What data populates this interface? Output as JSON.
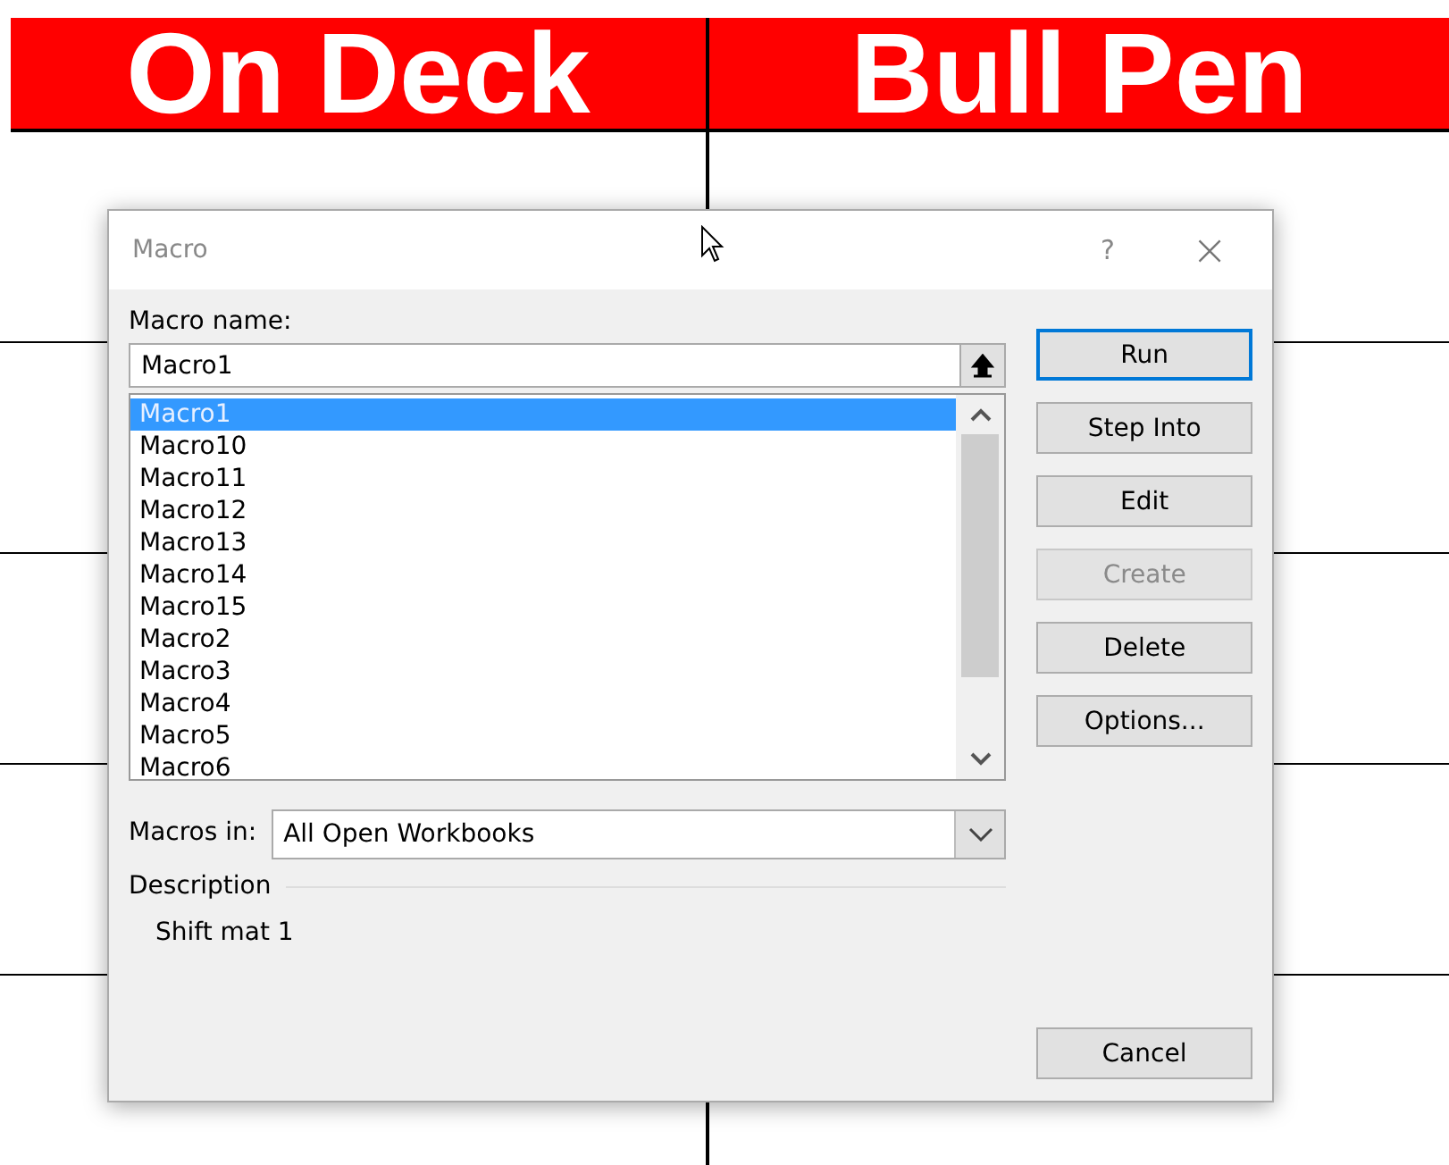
{
  "sheet": {
    "headers": [
      "On Deck",
      "Bull Pen"
    ]
  },
  "dialog": {
    "title": "Macro",
    "help": "?",
    "close": "×",
    "name_label": "Macro name:",
    "name_value": "Macro1",
    "macros": [
      {
        "label": "Macro1",
        "selected": true
      },
      {
        "label": "Macro10",
        "selected": false
      },
      {
        "label": "Macro11",
        "selected": false
      },
      {
        "label": "Macro12",
        "selected": false
      },
      {
        "label": "Macro13",
        "selected": false
      },
      {
        "label": "Macro14",
        "selected": false
      },
      {
        "label": "Macro15",
        "selected": false
      },
      {
        "label": "Macro2",
        "selected": false
      },
      {
        "label": "Macro3",
        "selected": false
      },
      {
        "label": "Macro4",
        "selected": false
      },
      {
        "label": "Macro5",
        "selected": false
      },
      {
        "label": "Macro6",
        "selected": false
      }
    ],
    "buttons": [
      {
        "label": "Run",
        "default": true,
        "disabled": false
      },
      {
        "label": "Step Into",
        "default": false,
        "disabled": false
      },
      {
        "label": "Edit",
        "default": false,
        "disabled": false
      },
      {
        "label": "Create",
        "default": false,
        "disabled": true
      },
      {
        "label": "Delete",
        "default": false,
        "disabled": false
      },
      {
        "label": "Options...",
        "default": false,
        "disabled": false
      }
    ],
    "macros_in_label": "Macros in:",
    "macros_in_value": "All Open Workbooks",
    "description_label": "Description",
    "description": "Shift mat 1",
    "cancel": "Cancel"
  }
}
